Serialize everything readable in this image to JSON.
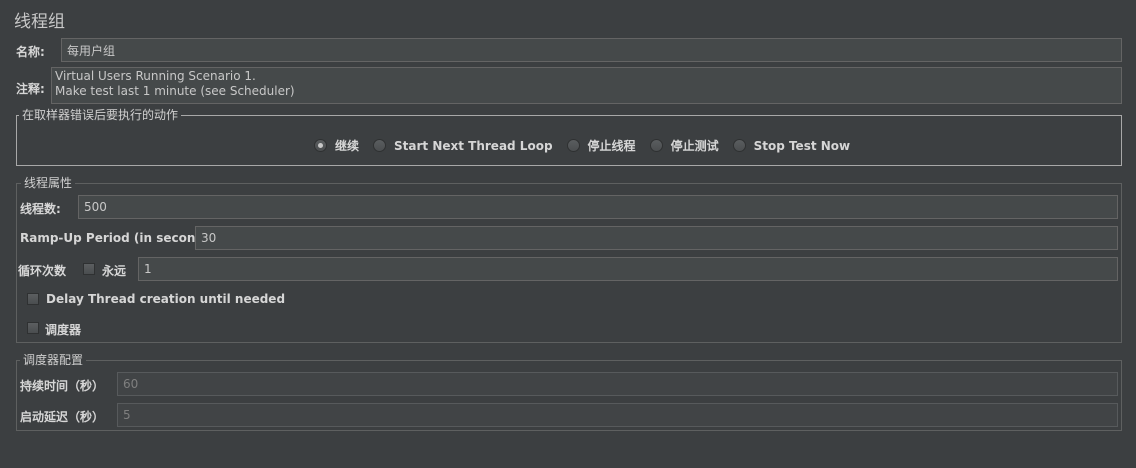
{
  "title": "线程组",
  "name": {
    "label": "名称:",
    "value": "每用户组"
  },
  "comment": {
    "label": "注释:",
    "lines": [
      "Virtual Users Running Scenario 1.",
      "Make test last 1 minute (see Scheduler)"
    ]
  },
  "error_action": {
    "legend": "在取样器错误后要执行的动作",
    "options": [
      "继续",
      "Start Next Thread Loop",
      "停止线程",
      "停止测试",
      "Stop Test Now"
    ],
    "selected": "继续"
  },
  "thread_props": {
    "legend": "线程属性",
    "threads_label": "线程数:",
    "threads_value": "500",
    "rampup_label": "Ramp-Up Period (in seconds):",
    "rampup_value": "30",
    "loop_label": "循环次数",
    "forever_label": "永远",
    "forever_checked": false,
    "loop_value": "1",
    "delay_label": "Delay Thread creation until needed",
    "delay_checked": false,
    "scheduler_label": "调度器",
    "scheduler_checked": false
  },
  "scheduler_config": {
    "legend": "调度器配置",
    "duration_label": "持续时间（秒）",
    "duration_value": "60",
    "startup_delay_label": "启动延迟（秒）",
    "startup_delay_value": "5"
  }
}
